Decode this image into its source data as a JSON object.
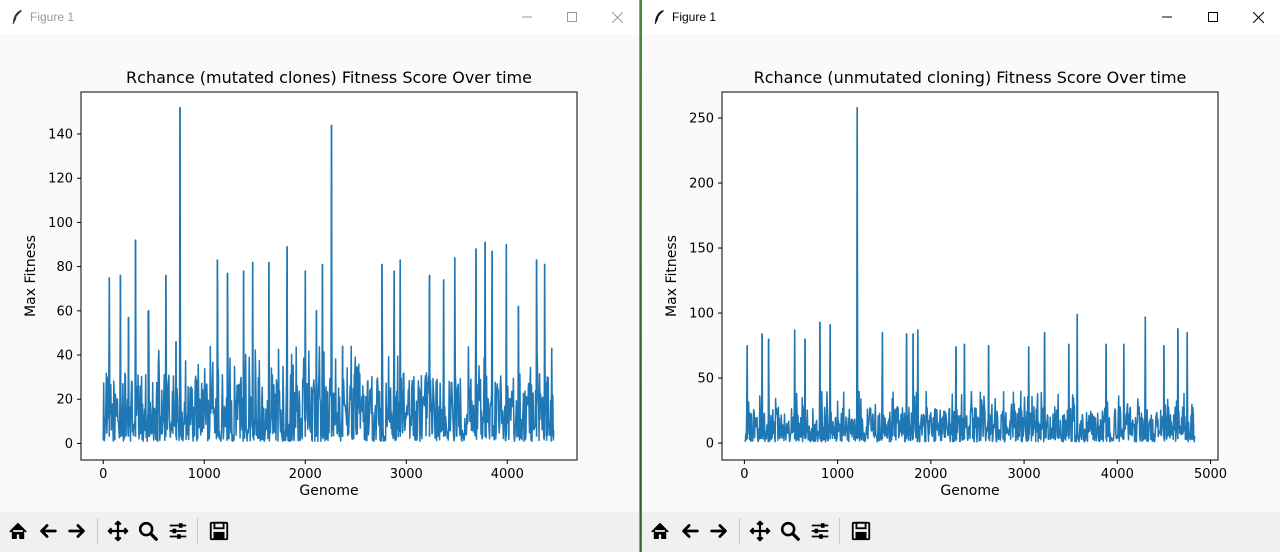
{
  "windows": [
    {
      "title": "Figure 1",
      "active": false,
      "chart_data": {
        "type": "line",
        "title": "Rchance (mutated clones) Fitness Score Over time",
        "xlabel": "Genome",
        "ylabel": "Max Fitness",
        "xlim": [
          -220,
          4690
        ],
        "ylim": [
          -7.5,
          159
        ],
        "xticks": [
          0,
          1000,
          2000,
          3000,
          4000
        ],
        "yticks": [
          0,
          20,
          40,
          60,
          80,
          100,
          120,
          140
        ],
        "n_points": 4460,
        "baseline_range": [
          1,
          32
        ],
        "series": [
          {
            "color": "#1f77b4",
            "spikes": [
              {
                "x": 60,
                "y": 75
              },
              {
                "x": 170,
                "y": 76
              },
              {
                "x": 250,
                "y": 57
              },
              {
                "x": 320,
                "y": 92
              },
              {
                "x": 445,
                "y": 60
              },
              {
                "x": 620,
                "y": 76
              },
              {
                "x": 720,
                "y": 46
              },
              {
                "x": 760,
                "y": 152
              },
              {
                "x": 1130,
                "y": 83
              },
              {
                "x": 1230,
                "y": 77
              },
              {
                "x": 1390,
                "y": 78
              },
              {
                "x": 1480,
                "y": 82
              },
              {
                "x": 1640,
                "y": 82
              },
              {
                "x": 1820,
                "y": 89
              },
              {
                "x": 2000,
                "y": 78
              },
              {
                "x": 2110,
                "y": 60
              },
              {
                "x": 2170,
                "y": 81
              },
              {
                "x": 2260,
                "y": 144
              },
              {
                "x": 2370,
                "y": 44
              },
              {
                "x": 2760,
                "y": 81
              },
              {
                "x": 2880,
                "y": 78
              },
              {
                "x": 2940,
                "y": 83
              },
              {
                "x": 3230,
                "y": 76
              },
              {
                "x": 3370,
                "y": 74
              },
              {
                "x": 3480,
                "y": 84
              },
              {
                "x": 3690,
                "y": 88
              },
              {
                "x": 3780,
                "y": 91
              },
              {
                "x": 3850,
                "y": 87
              },
              {
                "x": 3990,
                "y": 90
              },
              {
                "x": 4110,
                "y": 62
              },
              {
                "x": 4290,
                "y": 83
              },
              {
                "x": 4370,
                "y": 81
              },
              {
                "x": 4440,
                "y": 43
              }
            ]
          }
        ]
      }
    },
    {
      "title": "Figure 1",
      "active": true,
      "chart_data": {
        "type": "line",
        "title": "Rchance (unmutated cloning) Fitness Score Over time",
        "xlabel": "Genome",
        "ylabel": "Max Fitness",
        "xlim": [
          -240,
          5080
        ],
        "ylim": [
          -13,
          270
        ],
        "xticks": [
          0,
          1000,
          2000,
          3000,
          4000,
          5000
        ],
        "yticks": [
          0,
          50,
          100,
          150,
          200,
          250
        ],
        "n_points": 4830,
        "baseline_range": [
          1,
          28
        ],
        "series": [
          {
            "color": "#1f77b4",
            "spikes": [
              {
                "x": 30,
                "y": 75
              },
              {
                "x": 190,
                "y": 84
              },
              {
                "x": 260,
                "y": 80
              },
              {
                "x": 540,
                "y": 87
              },
              {
                "x": 650,
                "y": 80
              },
              {
                "x": 810,
                "y": 93
              },
              {
                "x": 920,
                "y": 91
              },
              {
                "x": 1210,
                "y": 258
              },
              {
                "x": 1480,
                "y": 85
              },
              {
                "x": 1740,
                "y": 84
              },
              {
                "x": 1810,
                "y": 84
              },
              {
                "x": 1860,
                "y": 87
              },
              {
                "x": 2270,
                "y": 74
              },
              {
                "x": 2360,
                "y": 76
              },
              {
                "x": 2620,
                "y": 75
              },
              {
                "x": 3050,
                "y": 74
              },
              {
                "x": 3220,
                "y": 85
              },
              {
                "x": 3480,
                "y": 76
              },
              {
                "x": 3570,
                "y": 99
              },
              {
                "x": 3880,
                "y": 76
              },
              {
                "x": 4070,
                "y": 76
              },
              {
                "x": 4300,
                "y": 97
              },
              {
                "x": 4500,
                "y": 75
              },
              {
                "x": 4650,
                "y": 88
              },
              {
                "x": 4750,
                "y": 85
              }
            ]
          }
        ]
      }
    }
  ],
  "toolbar_icons": [
    "home-icon",
    "back-arrow-icon",
    "forward-arrow-icon",
    "pan-icon",
    "zoom-icon",
    "subplots-icon",
    "save-icon"
  ]
}
